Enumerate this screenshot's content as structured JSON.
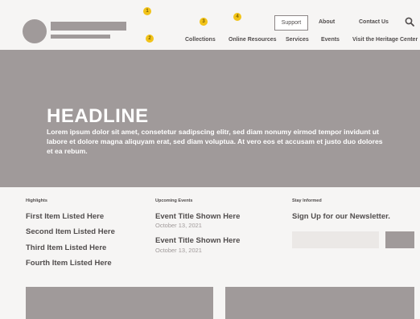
{
  "header": {
    "markers": [
      "1",
      "2",
      "3",
      "4",
      "5"
    ],
    "support_label": "Support",
    "nav_top": [
      "About",
      "Contact Us"
    ],
    "nav_bottom": [
      "Collections",
      "Online Resources",
      "Services",
      "Events",
      "Visit the Heritage Center"
    ],
    "search_icon": "search-icon"
  },
  "hero": {
    "headline": "HEADLINE",
    "body": "Lorem ipsum dolor sit amet, consetetur sadipscing elitr, sed diam nonumy eirmod tempor invidunt ut labore et dolore magna aliquyam erat, sed diam voluptua. At vero eos et accusam et justo duo dolores et ea rebum."
  },
  "highlights": {
    "heading": "Highlights",
    "items": [
      "First Item Listed Here",
      "Second Item Listed Here",
      "Third Item Listed Here",
      "Fourth Item Listed Here"
    ]
  },
  "events": {
    "heading": "Upcoming Events",
    "items": [
      {
        "title": "Event Title Shown Here",
        "date": "October 13, 2021"
      },
      {
        "title": "Event Title Shown Here",
        "date": "October 13, 2021"
      }
    ]
  },
  "newsletter": {
    "heading": "Stay Informed",
    "title": "Sign Up for our Newsletter.",
    "input_placeholder": "",
    "submit_label": ""
  },
  "colors": {
    "placeholder_gray": "#a09a9a",
    "text_dark": "#514d4d",
    "marker_yellow": "#f2c318",
    "page_bg": "#f6f5f4"
  }
}
